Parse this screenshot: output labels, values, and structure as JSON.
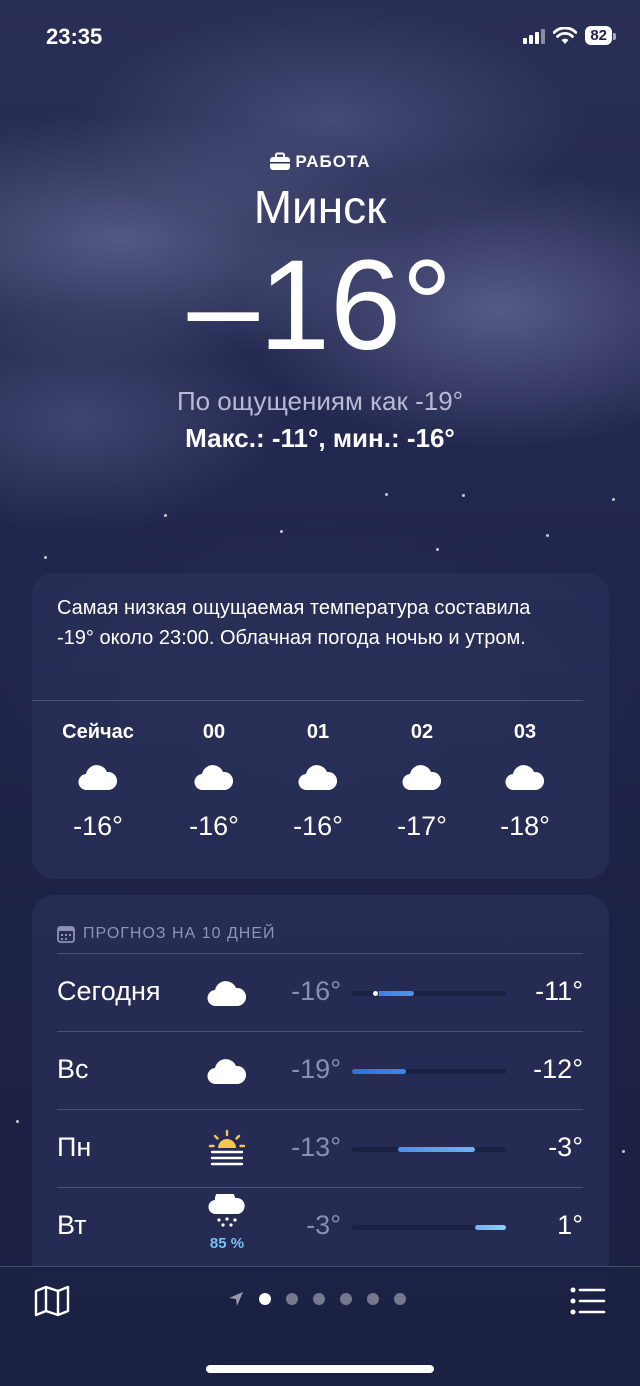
{
  "status_bar": {
    "time": "23:35",
    "battery": "82"
  },
  "location": {
    "label": "РАБОТА",
    "city": "Минск",
    "temperature": "–16°",
    "feels_like": "По ощущениям как -19°",
    "high_low": "Макс.: -11°, мин.: -16°"
  },
  "hourly": {
    "summary": "Самая низкая ощущаемая температура составила -19° около 23:00. Облачная погода ночью и утром.",
    "items": [
      {
        "time": "Сейчас",
        "icon": "cloud-icon",
        "temp": "-16°"
      },
      {
        "time": "00",
        "icon": "cloud-icon",
        "temp": "-16°"
      },
      {
        "time": "01",
        "icon": "cloud-icon",
        "temp": "-16°"
      },
      {
        "time": "02",
        "icon": "cloud-icon",
        "temp": "-17°"
      },
      {
        "time": "03",
        "icon": "cloud-icon",
        "temp": "-18°"
      }
    ]
  },
  "forecast": {
    "title": "ПРОГНОЗ НА 10 ДНЕЙ",
    "range": {
      "min": -19,
      "max": 1
    },
    "days": [
      {
        "day": "Сегодня",
        "icon": "cloud-icon",
        "precip": "",
        "low": "-16°",
        "high": "-11°",
        "low_val": -16,
        "high_val": -11,
        "current_val": -16,
        "colors": [
          "#3b7be4",
          "#4f96ec"
        ]
      },
      {
        "day": "Вс",
        "icon": "cloud-icon",
        "precip": "",
        "low": "-19°",
        "high": "-12°",
        "low_val": -19,
        "high_val": -12,
        "colors": [
          "#2f6fe0",
          "#3f86ea"
        ]
      },
      {
        "day": "Пн",
        "icon": "sunrise-fog-icon",
        "precip": "",
        "low": "-13°",
        "high": "-3°",
        "low_val": -13,
        "high_val": -3,
        "colors": [
          "#4a8fec",
          "#6fb3f3"
        ]
      },
      {
        "day": "Вт",
        "icon": "snow-cloud-icon",
        "precip": "85 %",
        "low": "-3°",
        "high": "1°",
        "low_val": -3,
        "high_val": 1,
        "colors": [
          "#6ab7f2",
          "#8bd1f4"
        ]
      }
    ]
  },
  "bottom_bar": {
    "pages": 6,
    "active_page": 0
  }
}
